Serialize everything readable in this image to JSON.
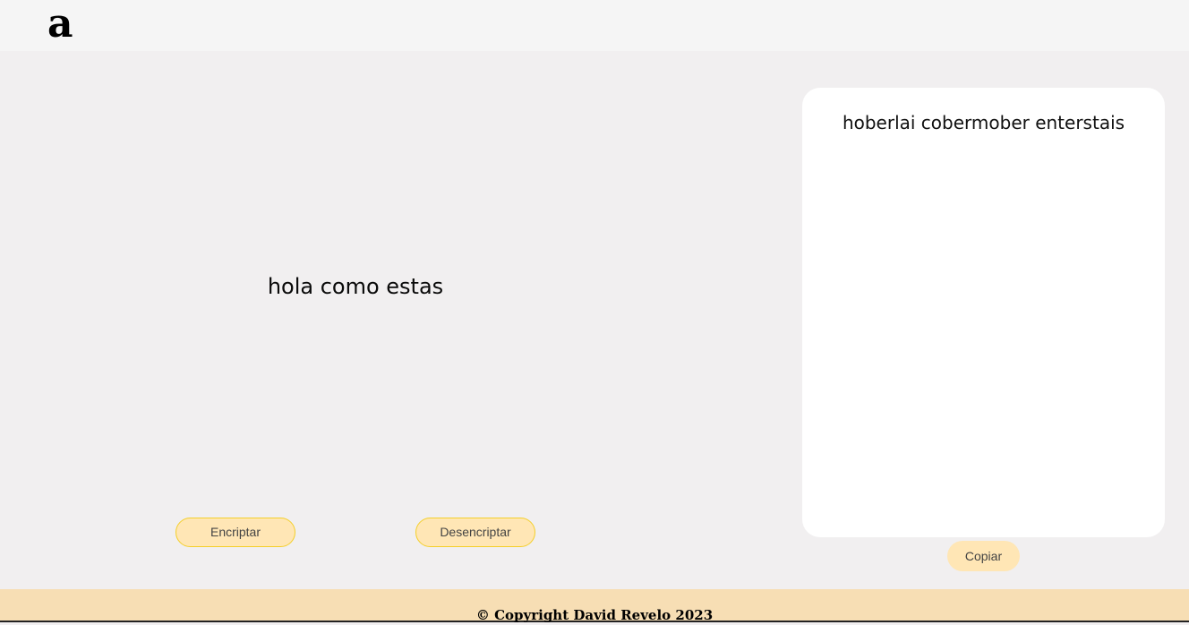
{
  "header": {
    "logo_text": "a"
  },
  "main": {
    "input_text": "hola como estas",
    "encrypt_label": "Encriptar",
    "decrypt_label": "Desencriptar"
  },
  "output": {
    "result_text": "hoberlai cobermober enterstais",
    "copy_label": "Copiar"
  },
  "footer": {
    "copyright": "© Copyright David Revelo 2023"
  },
  "colors": {
    "background": "#f1eff0",
    "header_bg": "#f5f5f5",
    "button_bg": "#ffe6b5",
    "button_border": "#f4cf2a",
    "footer_bg": "#f7deb4"
  }
}
